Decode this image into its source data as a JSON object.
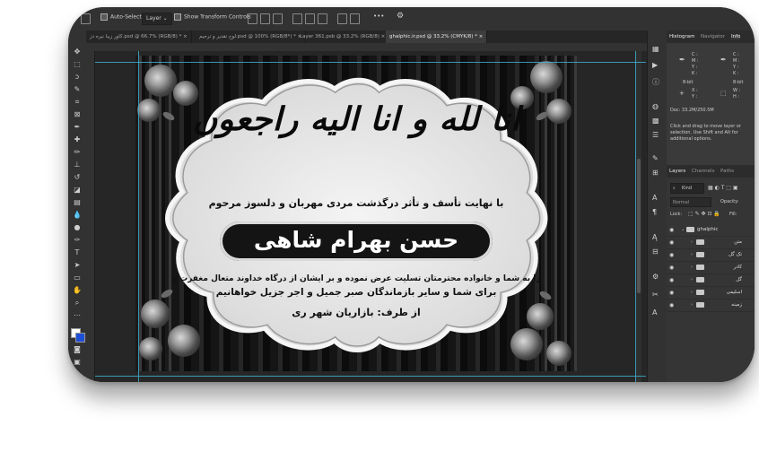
{
  "options_bar": {
    "auto_select_label": "Auto-Select:",
    "auto_select_value": "Layer",
    "show_transform_label": "Show Transform Controls",
    "more_label": "•••"
  },
  "tabs": [
    {
      "label": "کاور زیبا نیره دز.psd @ 66.7% (RGB/8) *"
    },
    {
      "label": "لوح تقدیر و ترحیم.psd @ 100% (RGB/8*) *"
    },
    {
      "label": "Layer 361.psb @ 33.2% (RGB/8)"
    },
    {
      "label": "ghalphic.ir.psd @ 33.2% (CMYK/8) *"
    }
  ],
  "panels": {
    "top_tabs": {
      "histogram": "Histogram",
      "navigator": "Navigator",
      "info": "Info"
    },
    "info": {
      "c": "C :",
      "m": "M :",
      "y": "Y :",
      "k": "K :",
      "bits_left": "8-bit",
      "bits_right": "8-bit",
      "x": "X :",
      "y2": "Y :",
      "w": "W :",
      "h": "H :",
      "doc": "Doc: 33.2M/250.5M",
      "hint": "Click and drag to move layer or selection. Use Shift and Alt for additional options."
    },
    "layers_tabs": {
      "layers": "Layers",
      "channels": "Channels",
      "paths": "Paths"
    },
    "kind_label": "Kind",
    "blend_mode": "Normal",
    "opacity_label": "Opacity:",
    "lock_label": "Lock:",
    "fill_label": "Fill:",
    "layers": [
      {
        "name": "ghalphic"
      },
      {
        "name": "متن"
      },
      {
        "name": "تک گل"
      },
      {
        "name": "کادر"
      },
      {
        "name": "گل"
      },
      {
        "name": "اسلیمی"
      },
      {
        "name": "زمینه"
      }
    ]
  },
  "design": {
    "calligraphy": "انا لله و انا الیه راجعون",
    "subtitle": "با نهایت تأسف و تأثر درگذشت مردی مهربان و دلسوز مرحوم",
    "name": "حسن بهرام شاهی",
    "body_line1": "را به شما و خانواده محترمتان تسلیت عرض نموده و بر ایشان از درگاه خداوند متعال مغفرت و",
    "body_line2": "برای شما و سایر بازماندگان صبر جمیل و اجر جزیل خواهانیم",
    "from": "از طرف: بازاریان شهر ری"
  },
  "colors": {
    "guide": "#3fb6d8",
    "foreground": "#ffffff",
    "background": "#1f4fd6"
  }
}
